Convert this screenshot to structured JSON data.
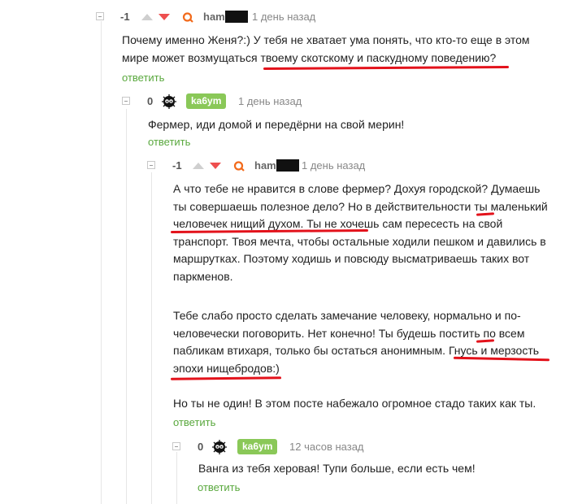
{
  "comments": [
    {
      "rating": "-1",
      "username": "ham",
      "time": "1 день назад",
      "text_pre": "Почему именно Женя?:) У тебя не хватает ума понять, что кто-то еще в этом мире может возмущаться ",
      "text_hl": "твоему скотскому и паскудному поведению?",
      "reply": "ответить"
    },
    {
      "rating": "0",
      "username": "ka6ym",
      "time": "1 день назад",
      "text": "Фермер, иди домой и передёрни на свой мерин!",
      "reply": "ответить"
    },
    {
      "rating": "-1",
      "username": "ham",
      "time": "1 день назад",
      "p1_pre": "А что тебе не нравится в слове фермер? Дохуя городской? Думаешь ты совершаешь полезное дело? Но в действительности ",
      "p1_hl": "ты маленький человечек нищий духом",
      "p1_post": ". Ты не хочешь сам пересесть на свой транспорт. Твоя мечта, чтобы остальные ходили пешком и давились в маршрутках. Поэтому ходишь и повсюду высматриваешь таких вот паркменов.",
      "p2_pre": "Тебе слабо просто сделать замечание человеку, нормально и по-человечески поговорить. Нет конечно! Ты будешь постить по всем пабликам втихаря, только бы остаться анонимным. ",
      "p2_hl": "Гнусь и мерзость эпохи нищебродов:)",
      "p3": "Но ты не один! В этом посте набежало огромное стадо таких как ты.",
      "reply": "ответить"
    },
    {
      "rating": "0",
      "username": "ka6ym",
      "time": "12 часов назад",
      "text": "Ванга из тебя херовая! Тупи больше, если есть чем!",
      "reply": "ответить"
    }
  ],
  "colors": {
    "accent_green": "#59a83d",
    "badge_green": "#8ac858",
    "downvote_red": "#ee4f4f",
    "highlight_red": "#e3121b"
  },
  "icons": {
    "collapse": "collapse-minus-icon",
    "upvote": "upvote-arrow-icon",
    "downvote": "downvote-arrow-icon",
    "author": "op-author-icon",
    "avatar": "soot-sprite-avatar"
  }
}
